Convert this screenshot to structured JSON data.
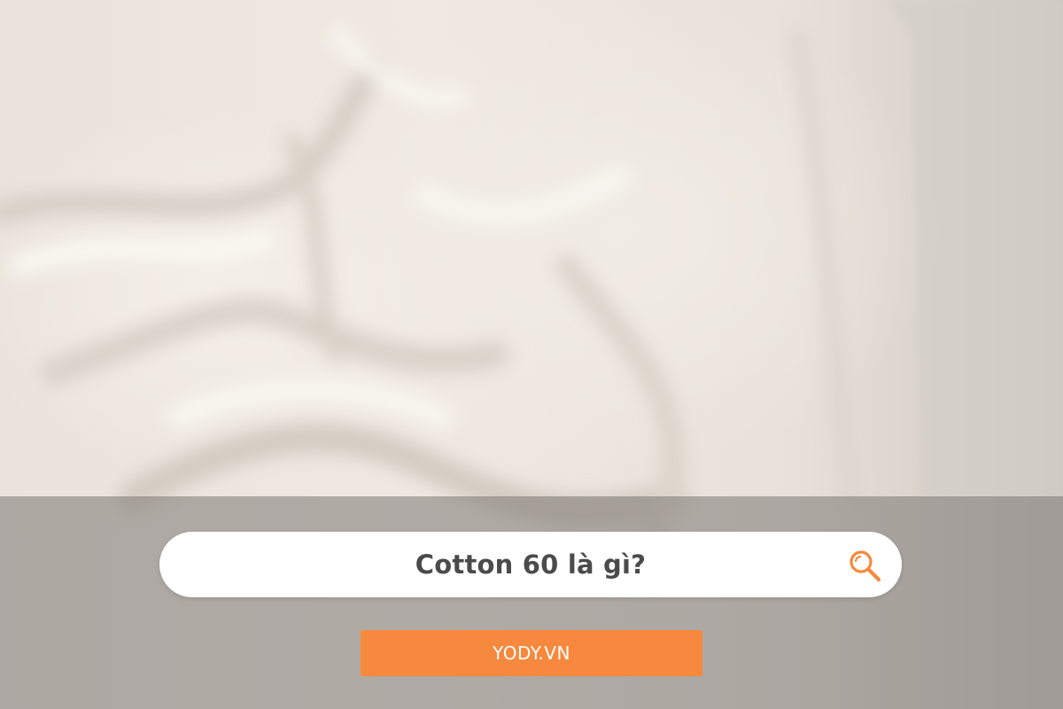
{
  "search": {
    "query": "Cotton 60 là gì?",
    "icon": "search-icon"
  },
  "brand": {
    "label": "YODY.VN"
  },
  "colors": {
    "accent": "#f6893d",
    "search_text": "#4b4b4b",
    "band_overlay": "#76726f",
    "fabric": "#efe9e1"
  }
}
